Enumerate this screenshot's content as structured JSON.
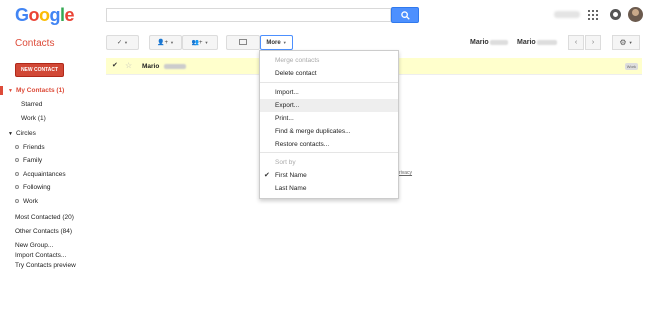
{
  "header": {
    "logo_text": "Google",
    "logo_colors": [
      "#4285f4",
      "#ea4335",
      "#fbbc05",
      "#4285f4",
      "#34a853",
      "#ea4335"
    ],
    "search_icon": "search-icon"
  },
  "toolbar": {
    "app_title": "Contacts",
    "select_label": "✓",
    "add_person_label": "👤+",
    "add_group_label": "👥+",
    "more_label": "More",
    "name_1": "Mario",
    "name_2": "Mario",
    "prev_label": "‹",
    "next_label": "›",
    "gear_label": "⚙"
  },
  "sidebar": {
    "new_contact_label": "NEW CONTACT",
    "my_contacts": "My Contacts (1)",
    "starred": "Starred",
    "work": "Work (1)",
    "circles": "Circles",
    "circle_items": [
      "Friends",
      "Family",
      "Acquaintances",
      "Following",
      "Work"
    ],
    "most_contacted": "Most Contacted (20)",
    "other_contacts": "Other Contacts (84)",
    "new_group": "New Group...",
    "import_contacts": "Import Contacts...",
    "try_preview": "Try Contacts preview"
  },
  "contact_row": {
    "name": "Mario",
    "tag": "Work"
  },
  "privacy_text": "rivacy",
  "menu": {
    "merge_contacts": "Merge contacts",
    "delete_contact": "Delete contact",
    "import": "Import...",
    "export": "Export...",
    "print": "Print...",
    "find_merge": "Find & merge duplicates...",
    "restore": "Restore contacts...",
    "sort_by": "Sort by",
    "first_name": "First Name",
    "last_name": "Last Name"
  }
}
